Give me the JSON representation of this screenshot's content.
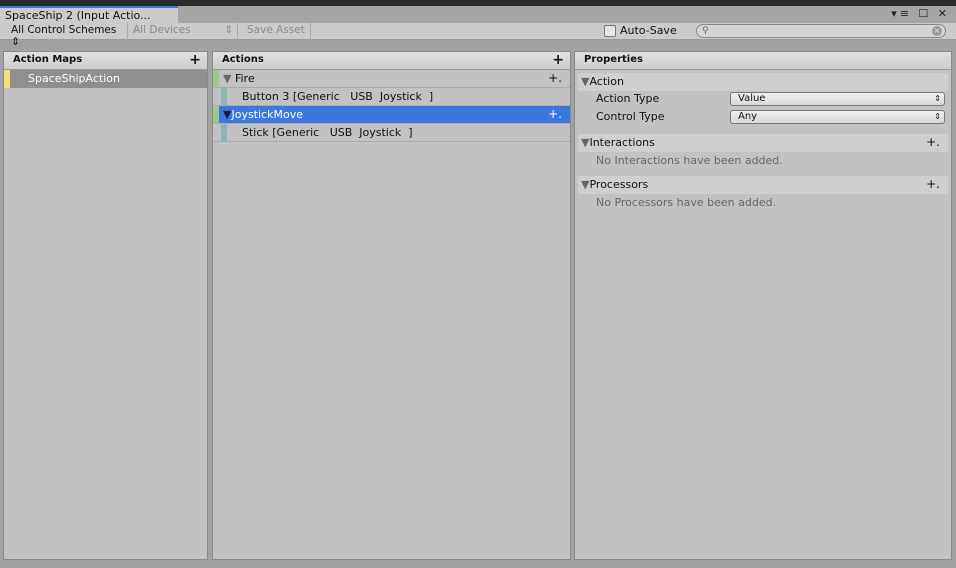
{
  "window": {
    "tab_title": "SpaceShip 2 (Input Actio...",
    "controls": "▾≡ ☐ ✕"
  },
  "toolbar": {
    "control_schemes": "All Control Schemes",
    "devices": "All Devices",
    "save_asset": "Save Asset",
    "auto_save": "Auto-Save",
    "search_placeholder": ""
  },
  "action_maps": {
    "header": "Action Maps",
    "items": [
      {
        "label": "SpaceShipAction",
        "color": "#f5dc7a"
      }
    ]
  },
  "actions": {
    "header": "Actions",
    "items": [
      {
        "label": "Fire",
        "bindings": [
          "Button 3 [Generic   USB  Joystick  ]"
        ]
      },
      {
        "label": "JoystickMove",
        "bindings": [
          "Stick [Generic   USB  Joystick  ]"
        ]
      }
    ]
  },
  "properties": {
    "header": "Properties",
    "action_section": "Action",
    "action_type_label": "Action Type",
    "action_type_value": "Value",
    "control_type_label": "Control Type",
    "control_type_value": "Any",
    "interactions": "Interactions",
    "interactions_empty": "No Interactions have been added.",
    "processors": "Processors",
    "processors_empty": "No Processors have been added."
  }
}
